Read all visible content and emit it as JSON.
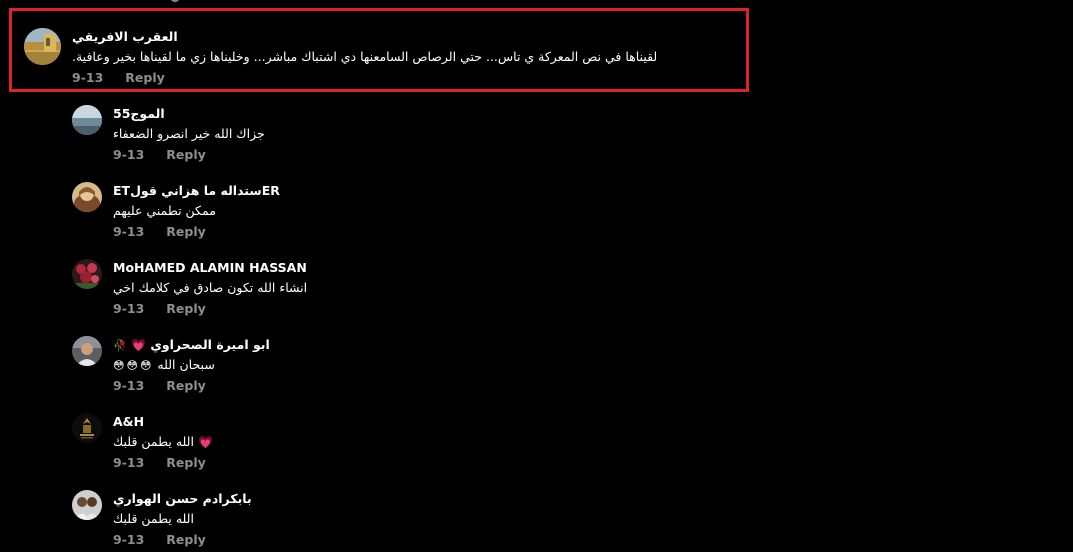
{
  "colors": {
    "background": "#000000",
    "highlight": "#e0202a",
    "meta_text": "#8e8e8e",
    "heart": "#e8325a"
  },
  "comments": [
    {
      "author": "العقرب الافريقي",
      "text": ".لقيناها في نص المعركة ي تاس... حتي الرصاص السامعنها دي اشتباك مباشر... وخليناها زي ما لقيناها بخير وعافية",
      "date": "9-13",
      "reply": "Reply",
      "avatar_icon": "desert-photo-avatar"
    },
    {
      "author": "الموج55",
      "text": "جزاك الله خير انصرو الضعفاء",
      "date": "9-13",
      "reply": "Reply",
      "avatar_icon": "sea-photo-avatar"
    },
    {
      "author": "ETستداله ما هزاني قولER",
      "text": "ممكن تطمني عليهم",
      "date": "9-13",
      "reply": "Reply",
      "avatar_icon": "portrait-avatar"
    },
    {
      "author": "MoHAMED ALAMIN HASSAN",
      "text": "انشاء الله تكون صادق في كلامك اخي",
      "date": "9-13",
      "reply": "Reply",
      "avatar_icon": "flowers-avatar"
    },
    {
      "author": "ابو اميرة الصحراوي",
      "author_emojis": [
        "💗",
        "🥀"
      ],
      "text": "سبحان الله",
      "text_emojis": [
        "😳",
        "😳",
        "😳"
      ],
      "date": "9-13",
      "reply": "Reply",
      "avatar_icon": "person-avatar"
    },
    {
      "author": "A&H",
      "text": "الله يطمن قلبك",
      "text_emojis": [
        "💗"
      ],
      "date": "9-13",
      "reply": "Reply",
      "avatar_icon": "emblem-avatar"
    },
    {
      "author": "بابكرادم حسن الهواري",
      "text": "الله يطمن قلبك",
      "date": "9-13",
      "reply": "Reply",
      "avatar_icon": "group-photo-avatar"
    }
  ]
}
